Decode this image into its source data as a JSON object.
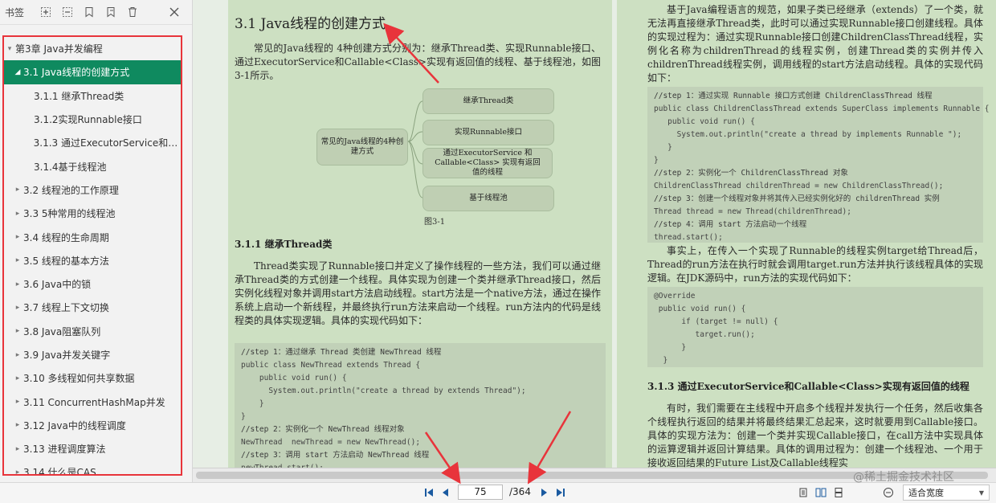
{
  "sidebar": {
    "title": "书签",
    "items": [
      {
        "label": "第3章 Java并发编程",
        "level": 0,
        "arrow": "▾"
      },
      {
        "label": "3.1 Java线程的创建方式",
        "level": 1,
        "arrow": "◢",
        "selected": true
      },
      {
        "label": "3.1.1 继承Thread类",
        "level": 2,
        "arrow": ""
      },
      {
        "label": "3.1.2实现Runnable接口",
        "level": 2,
        "arrow": ""
      },
      {
        "label": "3.1.3 通过ExecutorService和Call...",
        "level": 2,
        "arrow": ""
      },
      {
        "label": "3.1.4基于线程池",
        "level": 2,
        "arrow": ""
      },
      {
        "label": "3.2 线程池的工作原理",
        "level": 1,
        "arrow": "▸"
      },
      {
        "label": "3.3 5种常用的线程池",
        "level": 1,
        "arrow": "▸"
      },
      {
        "label": "3.4 线程的生命周期",
        "level": 1,
        "arrow": "▸"
      },
      {
        "label": "3.5 线程的基本方法",
        "level": 1,
        "arrow": "▸"
      },
      {
        "label": "3.6 Java中的锁",
        "level": 1,
        "arrow": "▸"
      },
      {
        "label": "3.7 线程上下文切换",
        "level": 1,
        "arrow": "▸"
      },
      {
        "label": "3.8 Java阻塞队列",
        "level": 1,
        "arrow": "▸"
      },
      {
        "label": "3.9 Java并发关键字",
        "level": 1,
        "arrow": "▸"
      },
      {
        "label": "3.10 多线程如何共享数据",
        "level": 1,
        "arrow": "▸"
      },
      {
        "label": "3.11 ConcurrentHashMap并发",
        "level": 1,
        "arrow": "▸"
      },
      {
        "label": "3.12 Java中的线程调度",
        "level": 1,
        "arrow": "▸"
      },
      {
        "label": "3.13 进程调度算法",
        "level": 1,
        "arrow": "▸"
      },
      {
        "label": "3.14 什么是CAS",
        "level": 1,
        "arrow": "▸"
      }
    ]
  },
  "doc_left": {
    "heading": "3.1 Java线程的创建方式",
    "intro": "常见的Java线程的 4种创建方式分别为：继承Thread类、实现Runnable接口、通过ExecutorService和Callable<Class>实现有返回值的线程、基于线程池，如图 3-1所示。",
    "mindmap": {
      "center": "常见的Java线程的4种创建方式",
      "nodes": [
        "继承Thread类",
        "实现Runnable接口",
        "通过ExecutorService 和 Callable<Class> 实现有返回值的线程",
        "基于线程池"
      ]
    },
    "caption": "图3-1",
    "sub_heading": "3.1.1 继承Thread类",
    "body": "Thread类实现了Runnable接口并定义了操作线程的一些方法，我们可以通过继承Thread类的方式创建一个线程。具体实现为创建一个类并继承Thread接口，然后实例化线程对象并调用start方法启动线程。start方法是一个native方法，通过在操作系统上启动一个新线程，并最终执行run方法来启动一个线程。run方法内的代码是线程类的具体实现逻辑。具体的实现代码如下：",
    "code": [
      "//step 1：通过继承 Thread 类创建 NewThread 线程",
      "public class NewThread extends Thread {",
      "    public void run() {",
      "      System.out.println(\"create a thread by extends Thread\");",
      "    }",
      "}",
      "//step 2：实例化一个 NewThread 线程对象",
      "NewThread  newThread = new NewThread();",
      "//step 3：调用 start 方法启动 NewThread 线程",
      "newThread.start();"
    ]
  },
  "doc_right": {
    "para1": "基于Java编程语言的规范，如果子类已经继承（extends）了一个类，就无法再直接继承Thread类，此时可以通过实现Runnable接口创建线程。具体的实现过程为：通过实现Runnable接口创建ChildrenClassThread线程，实例化名称为childrenThread的线程实例，创建Thread类的实例并传入childrenThread线程实例，调用线程的start方法启动线程。具体的实现代码如下：",
    "code1": [
      "//step 1：通过实现 Runnable 接口方式创建 ChildrenClassThread 线程",
      "public class ChildrenClassThread extends SuperClass implements Runnable {",
      "   public void run() {",
      "     System.out.println(\"create a thread by implements Runnable \");",
      "   }",
      "}",
      "//step 2：实例化一个 ChildrenClassThread 对象",
      "ChildrenClassThread childrenThread = new ChildrenClassThread();",
      "//step 3：创建一个线程对象并将其传入已经实例化好的 childrenThread 实例",
      "Thread thread = new Thread(childrenThread);",
      "//step 4：调用 start 方法启动一个线程",
      "thread.start();"
    ],
    "para2": "事实上，在传入一个实现了Runnable的线程实例target给Thread后，Thread的run方法在执行时就会调用target.run方法并执行该线程具体的实现逻辑。在JDK源码中，run方法的实现代码如下：",
    "code2": [
      "@Override",
      " public void run() {",
      "      if (target != null) {",
      "         target.run();",
      "      }",
      "  }"
    ],
    "sub_heading": "3.1.3 通过ExecutorService和Callable<Class>实现有返回值的线程",
    "para3": "有时，我们需要在主线程中开启多个线程并发执行一个任务，然后收集各个线程执行返回的结果并将最终结果汇总起来，这时就要用到Callable接口。具体的实现方法为：创建一个类并实现Callable接口，在call方法中实现具体的运算逻辑并返回计算结果。具体的调用过程为：创建一个线程池、一个用于接收返回结果的Future List及Callable线程实"
  },
  "footer": {
    "current_page": "75",
    "total_pages": "/364",
    "zoom": "适合宽度",
    "watermark": "@稀土掘金技术社区"
  },
  "colors": {
    "accent": "#0f8a5f",
    "highlight_border": "#e8343b",
    "page_bg": "#cde0c2"
  }
}
